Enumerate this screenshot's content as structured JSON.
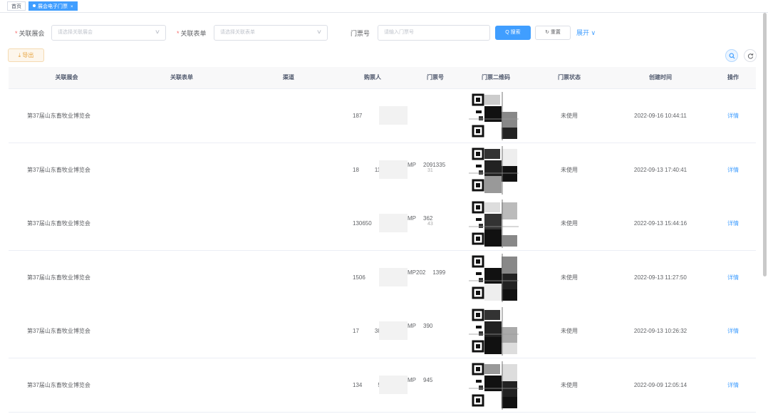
{
  "tabs": {
    "home": "首页",
    "active": "展会电子门票",
    "close": "×"
  },
  "search": {
    "exhibition_label": "关联展会",
    "exhibition_placeholder": "请选择关联展会",
    "form_label": "关联表单",
    "form_placeholder": "请选择关联表单",
    "ticket_label": "门票号",
    "ticket_placeholder": "请输入门票号",
    "search_button": "Q 搜索",
    "reset_button": "↻ 重置",
    "expand_link": "展开 ∨",
    "required_mark": "*",
    "chevron": "∨"
  },
  "toolbar": {
    "export_button": "⤓ 导出",
    "search_toggle_icon": "search-icon",
    "refresh_icon": "refresh-icon"
  },
  "table": {
    "headers": [
      "关联展会",
      "关联表单",
      "渠道",
      "购票人",
      "门票号",
      "门票二维码",
      "门票状态",
      "创建时间",
      "操作"
    ],
    "rows": [
      {
        "exhibition": "第37届山东畜牧业博览会",
        "form": "",
        "channel": "",
        "buyer": "187",
        "ticket_a": "",
        "ticket_b": "",
        "ticket_sub": "",
        "status": "未使用",
        "created": "2022-09-16 10:44:11",
        "action": "详情"
      },
      {
        "exhibition": "第37届山东畜牧业博览会",
        "form": "",
        "channel": "",
        "buyer": "18",
        "buyer_tail": "116",
        "ticket_a": "MP",
        "ticket_b": "2091335",
        "ticket_sub": "31",
        "status": "未使用",
        "created": "2022-09-13 17:40:41",
        "action": "详情"
      },
      {
        "exhibition": "第37届山东畜牧业博览会",
        "form": "",
        "channel": "",
        "buyer": "130650",
        "buyer_tail": "",
        "ticket_a": "MP",
        "ticket_b": "362",
        "ticket_sub": "43",
        "status": "未使用",
        "created": "2022-09-13 15:44:16",
        "action": "详情"
      },
      {
        "exhibition": "第37届山东畜牧业博览会",
        "form": "",
        "channel": "",
        "buyer": "1506",
        "buyer_tail": "",
        "ticket_a": "MP202",
        "ticket_b": "1399",
        "ticket_sub": "",
        "status": "未使用",
        "created": "2022-09-13 11:27:50",
        "action": "详情"
      },
      {
        "exhibition": "第37届山东畜牧业博览会",
        "form": "",
        "channel": "",
        "buyer": "17",
        "buyer_tail": "389",
        "ticket_a": "MP",
        "ticket_b": "390",
        "ticket_sub": "",
        "status": "未使用",
        "created": "2022-09-13 10:26:32",
        "action": "详情"
      },
      {
        "exhibition": "第37届山东畜牧业博览会",
        "form": "",
        "channel": "",
        "buyer": "134",
        "buyer_tail": "558",
        "ticket_a": "MP",
        "ticket_b": "945",
        "ticket_sub": "",
        "status": "未使用",
        "created": "2022-09-09 12:05:14",
        "action": "详情"
      }
    ]
  },
  "colors": {
    "primary": "#409eff",
    "warning": "#e6a23c",
    "required": "#f56c6c"
  }
}
